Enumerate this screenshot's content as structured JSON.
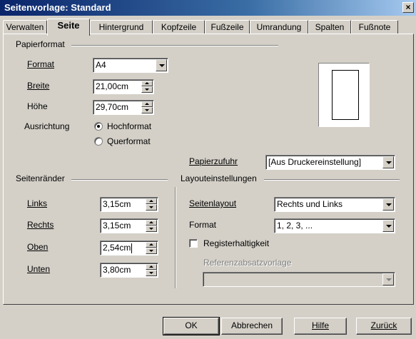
{
  "window": {
    "title": "Seitenvorlage: Standard",
    "close_glyph": "×"
  },
  "tabs": [
    {
      "label": "Verwalten"
    },
    {
      "label": "Seite",
      "active": true
    },
    {
      "label": "Hintergrund"
    },
    {
      "label": "Kopfzeile"
    },
    {
      "label": "Fußzeile"
    },
    {
      "label": "Umrandung"
    },
    {
      "label": "Spalten"
    },
    {
      "label": "Fußnote"
    }
  ],
  "paper": {
    "group_title": "Papierformat",
    "format_label": "Format",
    "format_value": "A4",
    "width_label": "Breite",
    "width_value": "21,00cm",
    "height_label": "Höhe",
    "height_value": "29,70cm",
    "orientation_label": "Ausrichtung",
    "portrait_label": "Hochformat",
    "landscape_label": "Querformat",
    "orientation_selected": "portrait",
    "tray_label": "Papierzufuhr",
    "tray_value": "[Aus Druckereinstellung]"
  },
  "margins": {
    "group_title": "Seitenränder",
    "left_label": "Links",
    "left_value": "3,15cm",
    "right_label": "Rechts",
    "right_value": "3,15cm",
    "top_label": "Oben",
    "top_value": "2,54cm",
    "bottom_label": "Unten",
    "bottom_value": "3,80cm"
  },
  "layout": {
    "group_title": "Layouteinstellungen",
    "page_layout_label": "Seitenlayout",
    "page_layout_value": "Rechts und Links",
    "format_label": "Format",
    "format_value": "1, 2, 3, ...",
    "register_label": "Registerhaltigkeit",
    "register_checked": false,
    "ref_style_label": "Referenzabsatzvorlage",
    "ref_style_value": ""
  },
  "buttons": {
    "ok": "OK",
    "cancel": "Abbrechen",
    "help": "Hilfe",
    "reset": "Zurück"
  }
}
